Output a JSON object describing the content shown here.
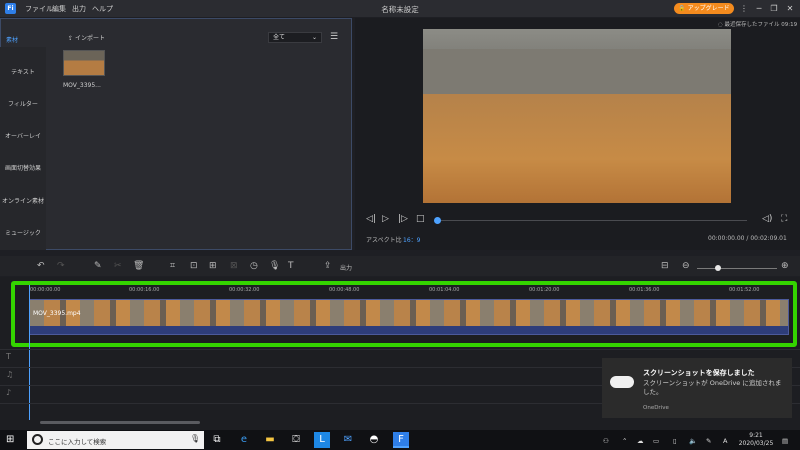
{
  "titlebar": {
    "logo": "Fi",
    "menu": [
      "ファイル",
      "編集",
      "出力",
      "ヘルプ"
    ],
    "title": "名称未設定",
    "upgrade": "🔒 アップグレード",
    "buttons": [
      "⋮",
      "─",
      "❐",
      "✕"
    ]
  },
  "media": {
    "tab_active": "素材",
    "tab_import": "インポート",
    "filter": "全て",
    "sidebar": [
      "テキスト",
      "フィルター",
      "オーバーレイ",
      "画面切替効果",
      "オンライン素材",
      "ミュージック"
    ],
    "clip_name": "MOV_3395..."
  },
  "preview": {
    "autosave": "◌ 最近保存したファイル 09:19",
    "aspect_label": "アスペクト比",
    "aspect_value": "16：9",
    "timecode": "00:00:00.00 / 00:02:09.01",
    "progress": 0.0
  },
  "toolbar": {
    "export_label": "出力"
  },
  "timeline": {
    "ruler": [
      "00:00:00.00",
      "00:00:16.00",
      "00:00:32.00",
      "00:00:48.00",
      "00:01:04.00",
      "00:01:20.00",
      "00:01:36.00",
      "00:01:52.00"
    ],
    "clip_label": "MOV_3395.mp4"
  },
  "toast": {
    "title": "スクリーンショットを保存しました",
    "body": "スクリーンショットが OneDrive に追加されました。",
    "source": "OneDrive"
  },
  "taskbar": {
    "search_placeholder": "ここに入力して検索",
    "ime": "A",
    "time": "9:21",
    "date": "2020/03/25"
  }
}
